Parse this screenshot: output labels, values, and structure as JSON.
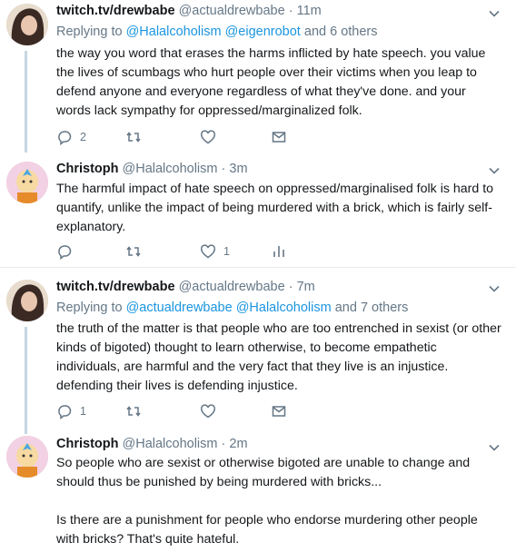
{
  "tweets": [
    {
      "name": "twitch.tv/drewbabe",
      "handle": "@actualdrewbabe",
      "dot": "·",
      "time": "11m",
      "replying_prefix": "Replying to",
      "replying_users": "@Halalcoholism @eigenrobot",
      "replying_suffix": "and 6 others",
      "text": "the way you word that erases the harms inflicted by hate speech. you value the lives of scumbags who hurt people over their victims when you leap to defend anyone and everyone regardless of what they've done. and your words lack sympathy for oppressed/marginalized folk.",
      "replies": "2",
      "retweets": "",
      "likes": ""
    },
    {
      "name": "Christoph",
      "handle": "@Halalcoholism",
      "dot": "·",
      "time": "3m",
      "text": "The harmful impact of hate speech on oppressed/marginalised folk is hard to quantify, unlike the impact of being murdered with a brick, which is fairly self-explanatory.",
      "replies": "",
      "retweets": "",
      "likes": "1"
    },
    {
      "name": "twitch.tv/drewbabe",
      "handle": "@actualdrewbabe",
      "dot": "·",
      "time": "7m",
      "replying_prefix": "Replying to",
      "replying_users": "@actualdrewbabe @Halalcoholism",
      "replying_suffix": "and 7 others",
      "text": "the truth of the matter is that people who are too entrenched in sexist (or other kinds of bigoted) thought to learn otherwise, to become empathetic individuals, are harmful and the very fact that they live is an injustice. defending their lives is defending injustice.",
      "replies": "1",
      "retweets": "",
      "likes": ""
    },
    {
      "name": "Christoph",
      "handle": "@Halalcoholism",
      "dot": "·",
      "time": "2m",
      "text": "So people who are sexist or otherwise bigoted are unable to change and should thus be punished by being murdered with bricks...\n\nIs there are a punishment for people who endorse murdering other people with bricks? That's quite hateful."
    }
  ],
  "colors": {
    "accent": "#1b95e0",
    "muted": "#657786",
    "thread": "#c5d7e3"
  },
  "icons": [
    "reply-icon",
    "retweet-icon",
    "like-icon",
    "message-icon",
    "analytics-icon",
    "chevron-down-icon"
  ]
}
